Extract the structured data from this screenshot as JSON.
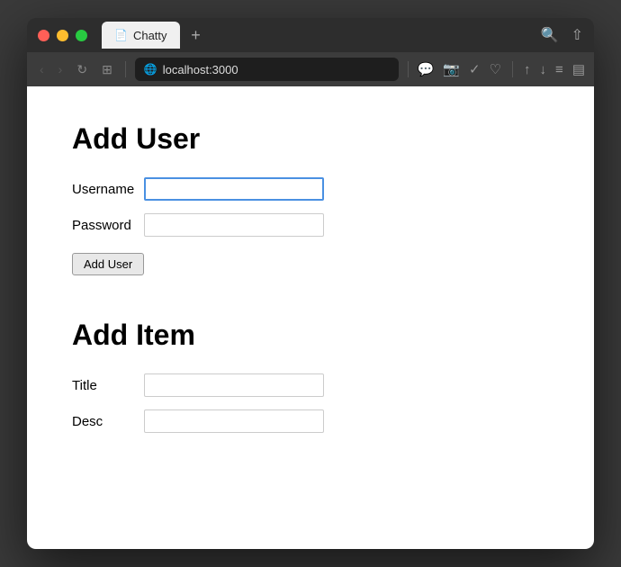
{
  "window": {
    "title": "Chatty",
    "url": "localhost:3000"
  },
  "tabs": [
    {
      "label": "Chatty",
      "icon": "📄",
      "active": true
    }
  ],
  "tab_new_label": "+",
  "nav": {
    "back": "‹",
    "forward": "›",
    "refresh": "↻",
    "grid": "⊞"
  },
  "address_bar": {
    "url": "localhost:3000"
  },
  "add_user_section": {
    "title": "Add User",
    "username_label": "Username",
    "username_placeholder": "",
    "password_label": "Password",
    "password_placeholder": "",
    "button_label": "Add User"
  },
  "add_item_section": {
    "title": "Add Item",
    "title_label": "Title",
    "title_placeholder": "",
    "desc_label": "Desc",
    "desc_placeholder": ""
  }
}
